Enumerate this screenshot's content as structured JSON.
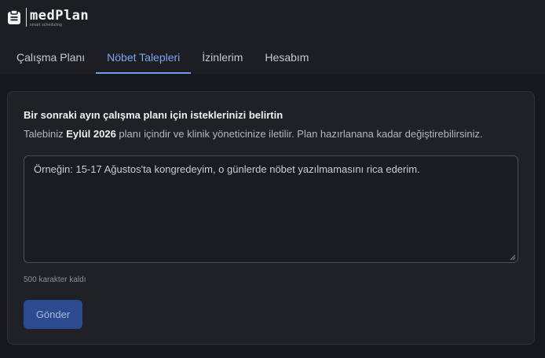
{
  "brand": {
    "name": "medPlan",
    "tagline": "smart scheduling",
    "icon": "clipboard-icon"
  },
  "tabs": [
    {
      "label": "Çalışma Planı",
      "active": false
    },
    {
      "label": "Nöbet Talepleri",
      "active": true
    },
    {
      "label": "İzinlerim",
      "active": false
    },
    {
      "label": "Hesabım",
      "active": false
    }
  ],
  "card": {
    "title": "Bir sonraki ayın çalışma planı için isteklerinizi belirtin",
    "desc_prefix": "Talebiniz ",
    "desc_period": "Eylül 2026",
    "desc_suffix": " planı içindir ve klinik yöneticinize iletilir. Plan hazırlanana kadar değiştirebilirsiniz.",
    "textarea_value": "",
    "textarea_placeholder": "Örneğin: 15-17 Ağustos'ta kongredeyim, o günlerde nöbet yazılmamasını rica ederim.",
    "char_count": "500 karakter kaldı",
    "submit_label": "Gönder"
  },
  "colors": {
    "accent": "#6d9eea",
    "button": "#2b4a8f",
    "background": "#16181c",
    "card": "#1f2126"
  }
}
